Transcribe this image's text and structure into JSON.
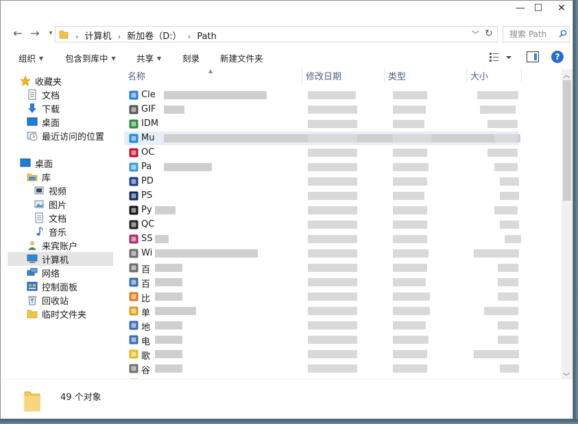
{
  "window": {
    "controls": {
      "minimize": "—",
      "maximize": "☐",
      "close": "✕"
    }
  },
  "nav": {
    "back_icon": "←",
    "forward_icon": "→",
    "history_icon": "▾",
    "breadcrumb": [
      "计算机",
      "新加卷（D:）",
      "Path"
    ],
    "refresh_icon": "↻",
    "dropdown_icon": "﹀",
    "search_placeholder": "搜索 Path"
  },
  "toolbar": {
    "organize": "组织",
    "include_in_library": "包含到库中",
    "share": "共享",
    "burn": "刻录",
    "new_folder": "新建文件夹",
    "help_glyph": "?"
  },
  "sidebar": {
    "favorites": {
      "label": "收藏夹",
      "items": [
        "文档",
        "下载",
        "桌面",
        "最近访问的位置"
      ]
    },
    "desktop": {
      "label": "桌面"
    },
    "library": {
      "label": "库",
      "items": [
        "视频",
        "图片",
        "文档",
        "音乐"
      ]
    },
    "others": [
      "来宾账户",
      "计算机",
      "网络",
      "控制面板",
      "回收站",
      "临时文件夹"
    ],
    "selected": "计算机"
  },
  "columns": [
    "名称",
    "修改日期",
    "类型",
    "大小"
  ],
  "files": [
    {
      "name": "Cle",
      "icon": "computer-app-icon",
      "color": "#2a7fd4"
    },
    {
      "name": "GIF",
      "icon": "monitor-icon",
      "color": "#555"
    },
    {
      "name": "IDM",
      "icon": "idm-icon",
      "color": "#2e8b3e"
    },
    {
      "name": "Mu",
      "icon": "music-app-icon",
      "color": "#1e88d8"
    },
    {
      "name": "OC",
      "icon": "red-app-icon",
      "color": "#c0102a"
    },
    {
      "name": "Pa",
      "icon": "globe-icon",
      "color": "#3a9bd8"
    },
    {
      "name": "PD",
      "icon": "pd-app-icon",
      "color": "#1e3a8a"
    },
    {
      "name": "PS",
      "icon": "ps-app-icon",
      "color": "#0b2a5c"
    },
    {
      "name": "Py",
      "icon": "pycharm-icon",
      "color": "#111"
    },
    {
      "name": "QC",
      "icon": "qq-penguin-icon",
      "color": "#222"
    },
    {
      "name": "SS",
      "icon": "ssh-app-icon",
      "color": "#b0286a"
    },
    {
      "name": "Wi",
      "icon": "installer-icon",
      "color": "#6a6a6a"
    },
    {
      "name": "百",
      "icon": "baidu-disk-icon",
      "color": "#6a6a6a"
    },
    {
      "name": "百",
      "icon": "window-app-icon",
      "color": "#3a6ab0"
    },
    {
      "name": "比",
      "icon": "orange-app-icon",
      "color": "#e07a20"
    },
    {
      "name": "单",
      "icon": "gear-app-icon",
      "color": "#d8a020"
    },
    {
      "name": "地",
      "icon": "window-app-icon",
      "color": "#3a6ab0"
    },
    {
      "name": "电",
      "icon": "window-app-icon",
      "color": "#3a6ab0"
    },
    {
      "name": "歌",
      "icon": "yellow-app-icon",
      "color": "#e8b820"
    },
    {
      "name": "谷",
      "icon": "disk-app-icon",
      "color": "#707070"
    },
    {
      "name": "里",
      "icon": "folder-icon",
      "color": "#e8b84a"
    }
  ],
  "highlighted_row_index": 3,
  "status": {
    "count": "49 个对象"
  }
}
